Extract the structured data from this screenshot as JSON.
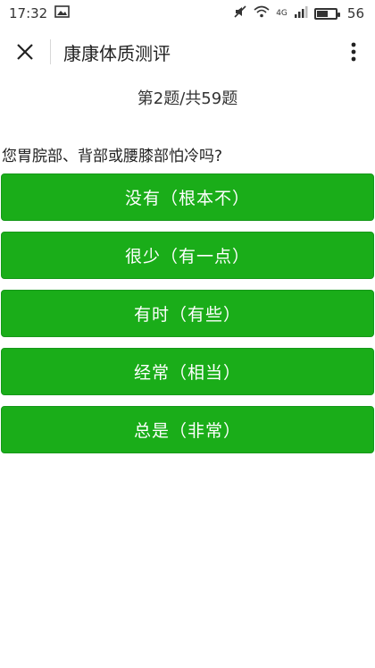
{
  "status_bar": {
    "time": "17:32",
    "network_label": "4G",
    "battery_percent": "56"
  },
  "nav": {
    "title": "康康体质测评"
  },
  "quiz": {
    "progress": "第2题/共59题",
    "question": "您胃脘部、背部或腰膝部怕冷吗?",
    "options": [
      "没有（根本不）",
      "很少（有一点）",
      "有时（有些）",
      "经常（相当）",
      "总是（非常）"
    ]
  },
  "colors": {
    "option_green": "#1aad19"
  }
}
